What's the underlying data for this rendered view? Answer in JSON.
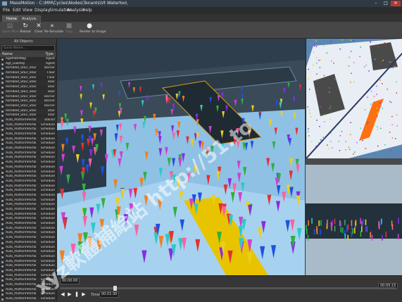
{
  "window": {
    "title": "MassMotion - C:\\MM\\Cycles\\Nodes\\Tenants\\Vt Waterloo\\",
    "controls": [
      "–",
      "□",
      "✕"
    ]
  },
  "menu": [
    "File",
    "Edit",
    "View",
    "Display",
    "Simulation",
    "Analysis",
    "Help"
  ],
  "ribbon_tabs": [
    "Home",
    "Analysis"
  ],
  "ribbon_buttons": [
    {
      "label": "Open Mod...",
      "icon": "open-folder-icon",
      "glyph": "▤",
      "enabled": false
    },
    {
      "label": "Reload",
      "icon": "reload-icon",
      "glyph": "↻",
      "enabled": true
    },
    {
      "label": "Clear",
      "icon": "clear-icon",
      "glyph": "✕",
      "enabled": true
    },
    {
      "label": "Re-Simulate",
      "icon": "fast-forward-icon",
      "glyph": "»",
      "enabled": true
    },
    {
      "label": "Stop",
      "icon": "stop-icon",
      "glyph": "■",
      "enabled": false
    },
    {
      "label": "Render to Image",
      "icon": "camera-icon",
      "glyph": "●",
      "enabled": true
    }
  ],
  "objects_panel": {
    "header": "All Objects",
    "search_placeholder": "Quick Name...",
    "columns": [
      "Name",
      "Type"
    ],
    "rows": [
      {
        "name": "AgotPathMap",
        "type": "Agent"
      },
      {
        "name": "Agt_LowPoly",
        "type": "Agent"
      },
      {
        "name": "Asmbled_Stair_Stair",
        "type": "Barrier"
      },
      {
        "name": "Asmbled_Stair_Stair",
        "type": "Floor"
      },
      {
        "name": "Asmbled_Stair_Stair",
        "type": "Floor"
      },
      {
        "name": "Asmbled_Stair_Stair",
        "type": "Stair"
      },
      {
        "name": "Asmbled_Stair_Stair",
        "type": "Stair"
      },
      {
        "name": "Asmbled_Stair_Stair",
        "type": "Stair"
      },
      {
        "name": "Asmbled_Stair_Stair",
        "type": "Barrier"
      },
      {
        "name": "Asmbled_Stair_Stair",
        "type": "Barrier"
      },
      {
        "name": "Asmbled_Stair_Stair",
        "type": "Barrier"
      },
      {
        "name": "Asmbled_Stair_Stair",
        "type": "Stair"
      },
      {
        "name": "Asmbled_Stair_Stair",
        "type": "Stair"
      },
      {
        "name": "Auto_PlatformPortal...",
        "type": "Stackif"
      },
      {
        "name": "Auto_PlatformPortal1",
        "type": "Schedule"
      },
      {
        "name": "Auto_PlatformPortal1-",
        "type": "Schedule"
      },
      {
        "name": "Auto_PlatformPortal1-",
        "type": "Schedule"
      },
      {
        "name": "Auto_PlatformPortal1-",
        "type": "Schedule"
      },
      {
        "name": "Auto_PlatformPortal1-",
        "type": "Schedule"
      },
      {
        "name": "Auto_PlatformPortal1-",
        "type": "Schedule"
      },
      {
        "name": "Auto_PlatformPortal1-",
        "type": "Schedule"
      },
      {
        "name": "Auto_PlatformPortal1-",
        "type": "Schedule"
      },
      {
        "name": "Auto_PlatformPortal1-",
        "type": "Schedule"
      },
      {
        "name": "Auto_PlatformPortal1-",
        "type": "Schedule"
      },
      {
        "name": "Auto_PlatformPortal1-",
        "type": "Schedule"
      },
      {
        "name": "Auto_PlatformPortal1-",
        "type": "Schedule"
      },
      {
        "name": "Auto_PlatformPortal1-",
        "type": "Schedule"
      },
      {
        "name": "Auto_PlatformPortal10-",
        "type": "Schedule"
      },
      {
        "name": "Auto_PlatformPortal10-",
        "type": "Schedule"
      },
      {
        "name": "Auto_PlatformPortal10-",
        "type": "Schedule"
      },
      {
        "name": "Auto_PlatformPortal10-",
        "type": "Schedule"
      },
      {
        "name": "Auto_PlatformPortal10-",
        "type": "Schedule"
      },
      {
        "name": "Auto_PlatformPortal10-",
        "type": "Schedule"
      },
      {
        "name": "Auto_PlatformPortal10-",
        "type": "Schedule"
      },
      {
        "name": "Auto_PlatformPortal10-",
        "type": "Schedule"
      },
      {
        "name": "Auto_PlatformPortal10-",
        "type": "Schedule"
      },
      {
        "name": "Auto_PlatformPortal2-",
        "type": "Schedule"
      },
      {
        "name": "Auto_PlatformPortal2-",
        "type": "Schedule"
      },
      {
        "name": "Auto_PlatformPortal2-",
        "type": "Schedule"
      },
      {
        "name": "Auto_PlatformPortal2-",
        "type": "Schedule"
      },
      {
        "name": "Auto_PlatformPortal2-",
        "type": "Schedule"
      },
      {
        "name": "Auto_PlatformPortal2-",
        "type": "Schedule"
      },
      {
        "name": "Auto_PlatformPortal2-",
        "type": "Schedule"
      },
      {
        "name": "Auto_PlatformPortal2-",
        "type": "Schedule"
      },
      {
        "name": "Auto_PlatformPortal2-",
        "type": "Schedule"
      },
      {
        "name": "Auto_PlatformPortal2-",
        "type": "Schedule"
      },
      {
        "name": "Auto_PlatformPortal2-",
        "type": "Schedule"
      },
      {
        "name": "Auto_PlatformPortal2-",
        "type": "Schedule"
      },
      {
        "name": "Auto_PlatformPortal2-",
        "type": "Schedule"
      },
      {
        "name": "Auto_PlatformPortal2-",
        "type": "Schedule"
      },
      {
        "name": "Auto_PlatformPortal2-",
        "type": "Schedule"
      },
      {
        "name": "Auto_PlatformPortal2-",
        "type": "Schedule"
      }
    ]
  },
  "timeline": {
    "start": "00:00:00",
    "time_label": "Time",
    "current": "00:01:30",
    "end": "00:05:15",
    "progress": 0.16
  },
  "watermark": "xyz軟體補給站 http://51.to",
  "colors": {
    "accent": "#e8c400",
    "floor": "#7ab0d8",
    "agent_palette": [
      "#e63030",
      "#e8d020",
      "#30b040",
      "#2050e0",
      "#d040d0",
      "#f08020",
      "#30c8c8",
      "#8a2be2",
      "#ff60a0"
    ]
  }
}
